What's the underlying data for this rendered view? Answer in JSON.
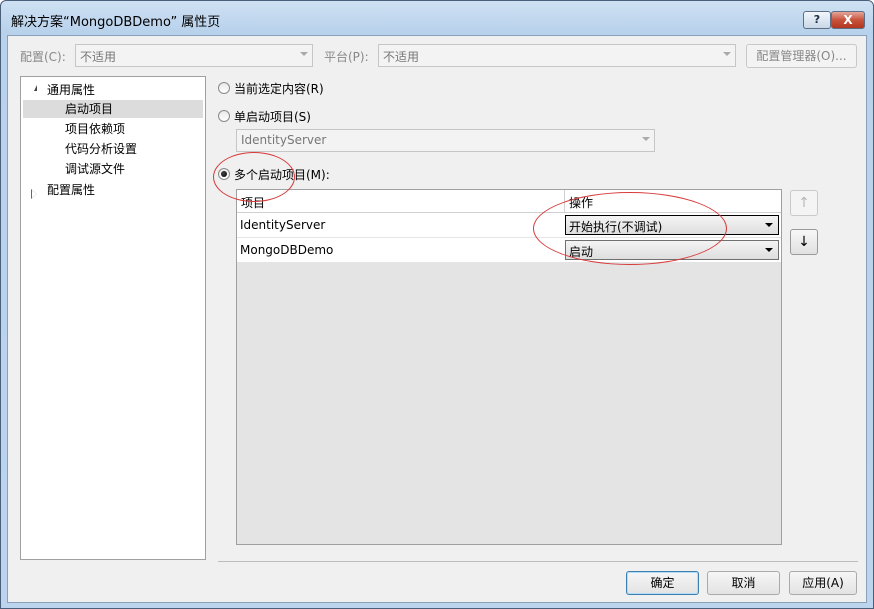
{
  "window": {
    "title": "解决方案“MongoDBDemo” 属性页",
    "help_label": "?",
    "close_label": "X"
  },
  "toolbar": {
    "config_label": "配置(C):",
    "config_value": "不适用",
    "platform_label": "平台(P):",
    "platform_value": "不适用",
    "config_manager_label": "配置管理器(O)..."
  },
  "tree": {
    "root": "通用属性",
    "children": [
      "启动项目",
      "项目依赖项",
      "代码分析设置",
      "调试源文件"
    ],
    "selected": "启动项目",
    "second_root": "配置属性"
  },
  "startup": {
    "current_selection_label": "当前选定内容(R)",
    "single_label": "单启动项目(S)",
    "single_value": "IdentityServer",
    "multiple_label": "多个启动项目(M):",
    "selected_option": "multiple"
  },
  "grid": {
    "headers": [
      "项目",
      "操作"
    ],
    "rows": [
      {
        "project": "IdentityServer",
        "action": "开始执行(不调试)"
      },
      {
        "project": "MongoDBDemo",
        "action": "启动"
      }
    ]
  },
  "move_buttons": {
    "up": "↑",
    "down": "↓"
  },
  "footer": {
    "ok": "确定",
    "cancel": "取消",
    "apply": "应用(A)"
  },
  "colors": {
    "annotation": "#d83a3a",
    "title_gradient_top": "#cfe1f3",
    "close_button": "#c7533c"
  }
}
